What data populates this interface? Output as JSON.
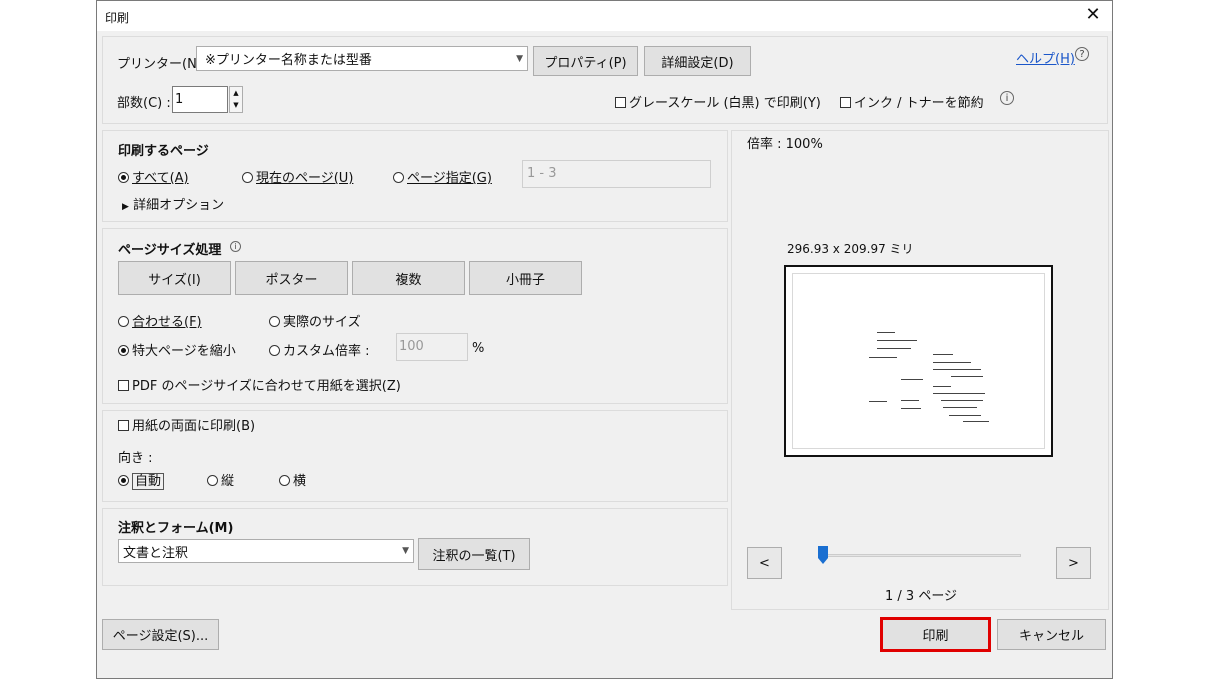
{
  "window": {
    "title": "印刷",
    "close_glyph": "✕"
  },
  "printer": {
    "label": "プリンター(N) :",
    "selected": "※プリンター名称または型番",
    "properties_button": "プロパティ(P)",
    "advanced_button": "詳細設定(D)",
    "help_link": "ヘルプ(H)"
  },
  "copies": {
    "label": "部数(C) :",
    "value": "1"
  },
  "options": {
    "grayscale": "グレースケール (白黒) で印刷(Y)",
    "save_ink": "インク / トナーを節約"
  },
  "pages_to_print": {
    "heading": "印刷するページ",
    "all": "すべて(A)",
    "current": "現在のページ(U)",
    "range": "ページ指定(G)",
    "range_value": "1 - 3",
    "more_options": "詳細オプション"
  },
  "page_sizing": {
    "heading": "ページサイズ処理",
    "buttons": [
      "サイズ(I)",
      "ポスター",
      "複数",
      "小冊子"
    ],
    "fit": "合わせる(F)",
    "actual_size": "実際のサイズ",
    "shrink": "特大ページを縮小",
    "custom_scale": "カスタム倍率 :",
    "custom_value": "100",
    "percent": "%",
    "choose_paper": "PDF のページサイズに合わせて用紙を選択(Z)"
  },
  "duplex": {
    "label": "用紙の両面に印刷(B)",
    "orientation_label": "向き :",
    "auto": "自動",
    "portrait": "縦",
    "landscape": "横"
  },
  "comments": {
    "heading": "注釈とフォーム(M)",
    "selected": "文書と注釈",
    "summary_button": "注釈の一覧(T)"
  },
  "preview": {
    "scale": "倍率 : 100%",
    "dimensions": "296.93 x 209.97 ミリ",
    "prev": "<",
    "next": ">",
    "page_indicator": "1 / 3 ページ",
    "position_fraction": 0
  },
  "footer": {
    "page_setup": "ページ設定(S)...",
    "print": "印刷",
    "cancel": "キャンセル"
  },
  "colors": {
    "highlight": "#e00000",
    "slider_thumb": "#1a6fd1",
    "link": "#1a56c9"
  }
}
